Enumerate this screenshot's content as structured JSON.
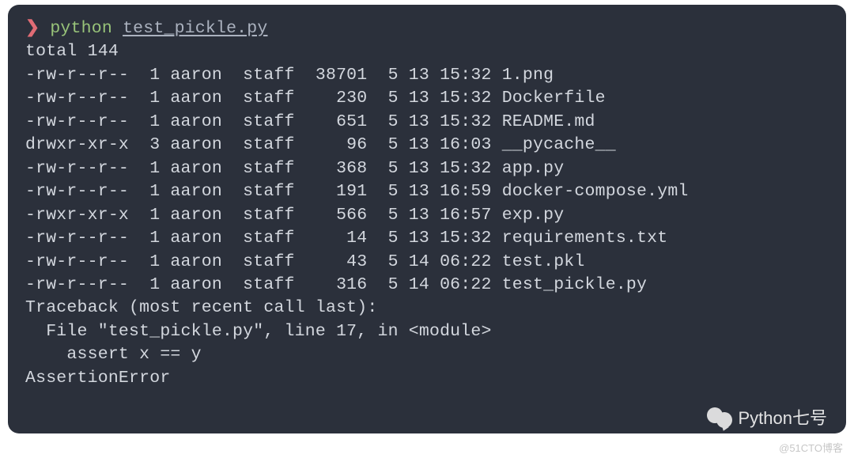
{
  "prompt": {
    "arrow": "❯",
    "command": "python",
    "argument": "test_pickle.py"
  },
  "ls_output": {
    "total_line": "total 144",
    "rows": [
      {
        "perms": "-rw-r--r--",
        "links": "1",
        "owner": "aaron",
        "group": "staff",
        "size": "38701",
        "month": "5",
        "day": "13",
        "time": "15:32",
        "name": "1.png"
      },
      {
        "perms": "-rw-r--r--",
        "links": "1",
        "owner": "aaron",
        "group": "staff",
        "size": "230",
        "month": "5",
        "day": "13",
        "time": "15:32",
        "name": "Dockerfile"
      },
      {
        "perms": "-rw-r--r--",
        "links": "1",
        "owner": "aaron",
        "group": "staff",
        "size": "651",
        "month": "5",
        "day": "13",
        "time": "15:32",
        "name": "README.md"
      },
      {
        "perms": "drwxr-xr-x",
        "links": "3",
        "owner": "aaron",
        "group": "staff",
        "size": "96",
        "month": "5",
        "day": "13",
        "time": "16:03",
        "name": "__pycache__"
      },
      {
        "perms": "-rw-r--r--",
        "links": "1",
        "owner": "aaron",
        "group": "staff",
        "size": "368",
        "month": "5",
        "day": "13",
        "time": "15:32",
        "name": "app.py"
      },
      {
        "perms": "-rw-r--r--",
        "links": "1",
        "owner": "aaron",
        "group": "staff",
        "size": "191",
        "month": "5",
        "day": "13",
        "time": "16:59",
        "name": "docker-compose.yml"
      },
      {
        "perms": "-rwxr-xr-x",
        "links": "1",
        "owner": "aaron",
        "group": "staff",
        "size": "566",
        "month": "5",
        "day": "13",
        "time": "16:57",
        "name": "exp.py"
      },
      {
        "perms": "-rw-r--r--",
        "links": "1",
        "owner": "aaron",
        "group": "staff",
        "size": "14",
        "month": "5",
        "day": "13",
        "time": "15:32",
        "name": "requirements.txt"
      },
      {
        "perms": "-rw-r--r--",
        "links": "1",
        "owner": "aaron",
        "group": "staff",
        "size": "43",
        "month": "5",
        "day": "14",
        "time": "06:22",
        "name": "test.pkl"
      },
      {
        "perms": "-rw-r--r--",
        "links": "1",
        "owner": "aaron",
        "group": "staff",
        "size": "316",
        "month": "5",
        "day": "14",
        "time": "06:22",
        "name": "test_pickle.py"
      }
    ]
  },
  "traceback": {
    "header": "Traceback (most recent call last):",
    "file_line": "  File \"test_pickle.py\", line 17, in <module>",
    "code_line": "    assert x == y",
    "error_line": "AssertionError"
  },
  "watermark": {
    "text": "Python七号"
  },
  "footer": {
    "text": "@51CTO博客"
  }
}
